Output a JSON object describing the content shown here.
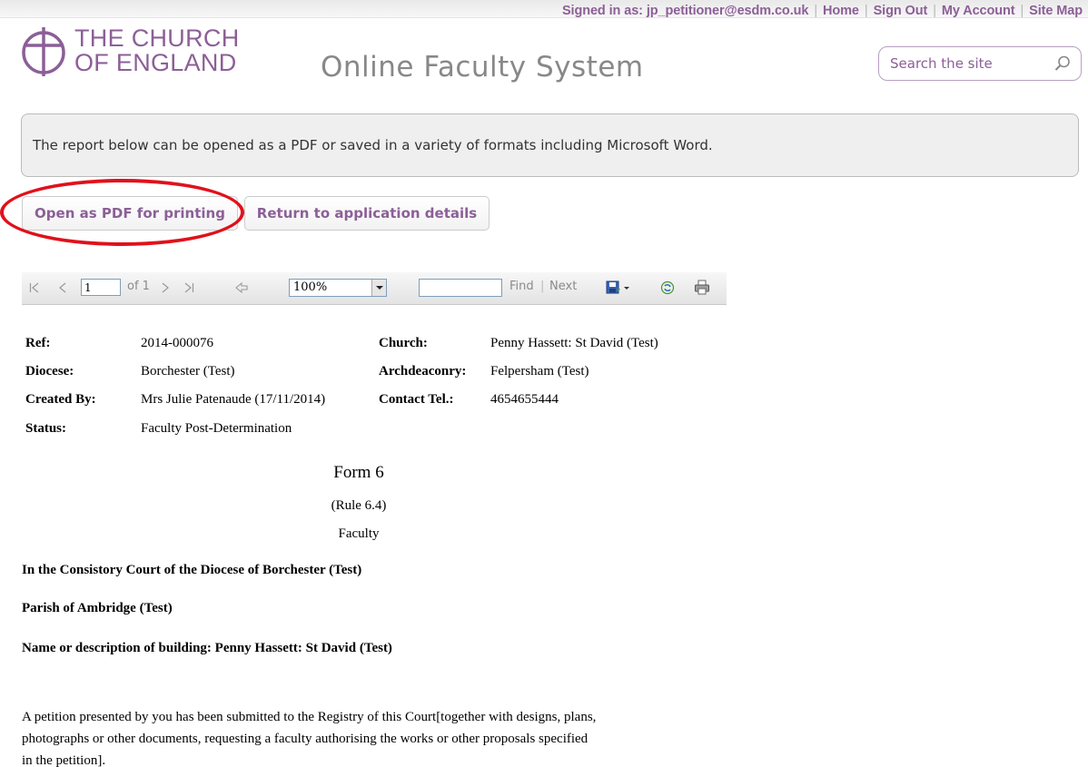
{
  "header": {
    "signed_in": "Signed in as: jp_petitioner@esdm.co.uk",
    "nav": [
      "Home",
      "Sign Out",
      "My Account",
      "Site Map"
    ],
    "logo_line1": "THE CHURCH",
    "logo_line2": "OF ENGLAND",
    "app_title": "Online Faculty System",
    "search_placeholder": "Search the site"
  },
  "info_text": "The report below can be opened as a PDF or saved in a variety of formats including Microsoft Word.",
  "buttons": {
    "open_pdf": "Open as PDF for printing",
    "return": "Return to application details"
  },
  "toolbar": {
    "page": "1",
    "of_pages": "of 1",
    "zoom": "100%",
    "find": "Find",
    "next": "Next"
  },
  "report": {
    "fields": {
      "ref_label": "Ref:",
      "ref": "2014-000076",
      "diocese_label": "Diocese:",
      "diocese": "Borchester (Test)",
      "created_label": "Created By:",
      "created": "Mrs Julie Patenaude (17/11/2014)",
      "status_label": "Status:",
      "status": "Faculty Post-Determination",
      "church_label": "Church:",
      "church": "Penny Hassett: St David (Test)",
      "archdeaconry_label": "Archdeaconry:",
      "archdeaconry": "Felpersham (Test)",
      "contact_label": "Contact Tel.:",
      "contact": "4654655444"
    },
    "form_title": "Form 6",
    "rule": "(Rule 6.4)",
    "faculty": "Faculty",
    "court": "In the Consistory Court of the Diocese of Borchester (Test)",
    "parish": "Parish of Ambridge (Test)",
    "building": "Name or description of building: Penny Hassett: St David (Test)",
    "paragraph_lines": [
      "A petition presented by you has been submitted to the Registry of this Court[together with designs, plans,",
      "photographs or other documents, requesting a faculty authorising the works or other proposals specified",
      "in the petition]."
    ]
  }
}
